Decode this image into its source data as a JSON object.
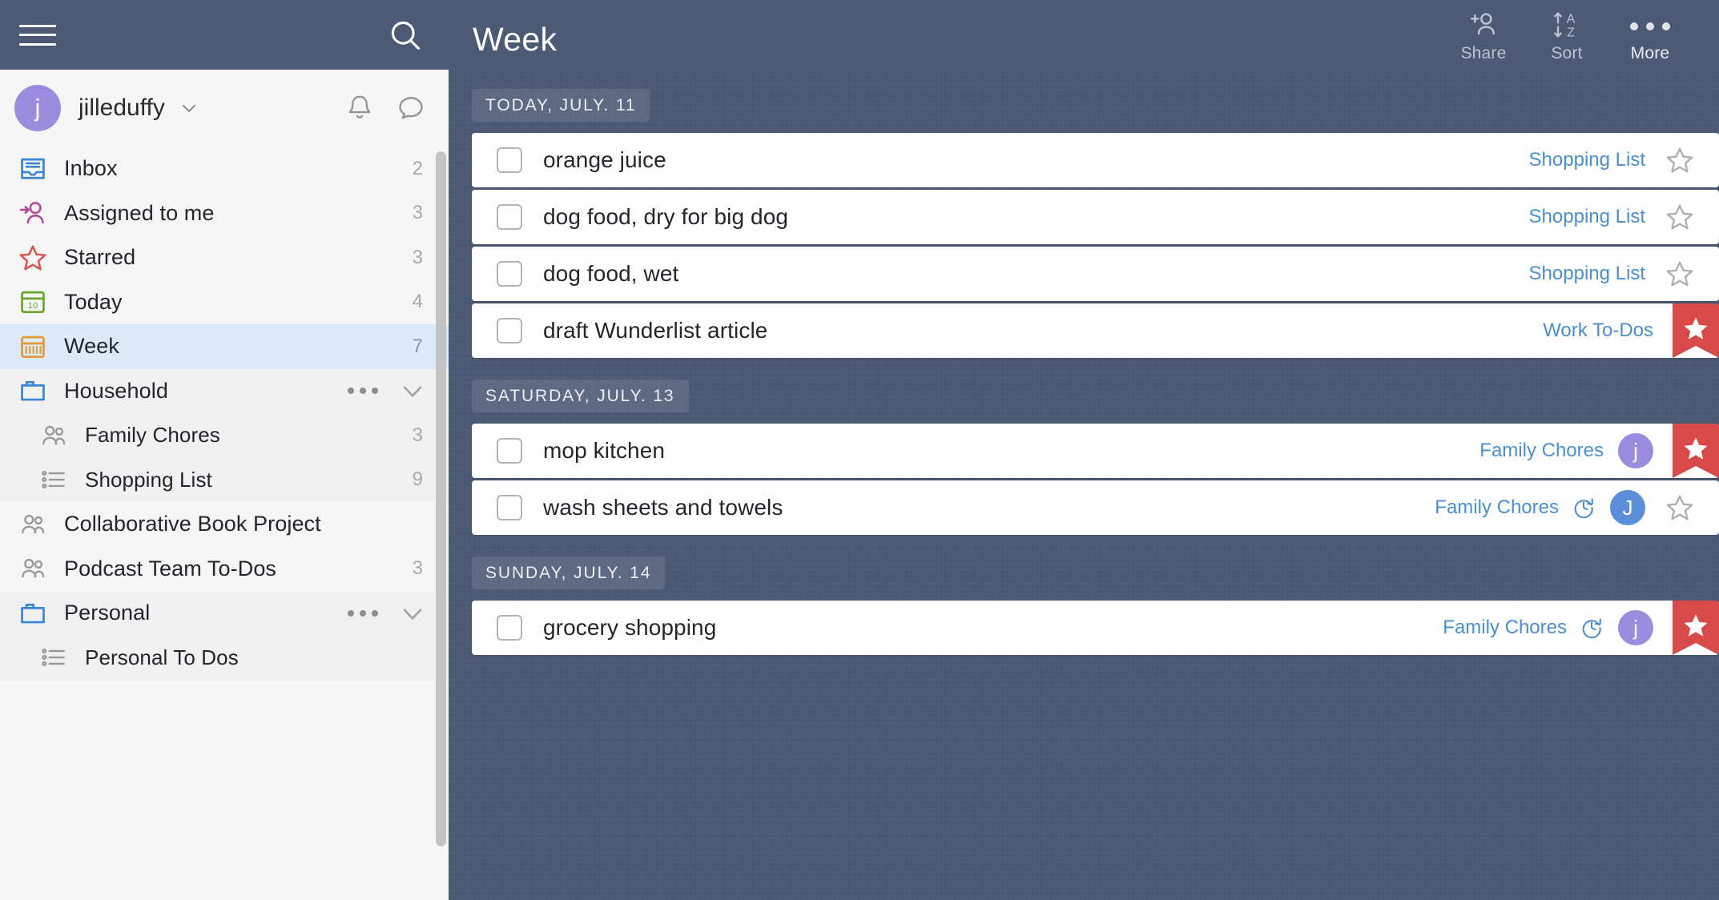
{
  "sidebar": {
    "search_icon": "search-icon",
    "menu_icon": "hamburger-icon",
    "user": {
      "avatar_initial": "j",
      "username": "jilleduffy",
      "avatar_color": "#9b8ce0",
      "dropdown_icon": "chevron-down-icon",
      "bell_icon": "bell-icon",
      "chat_icon": "chat-bubble-icon"
    },
    "smart_lists": [
      {
        "label": "Inbox",
        "count": "2",
        "icon": "inbox-icon",
        "color": "#3b86d6",
        "selected": false
      },
      {
        "label": "Assigned to me",
        "count": "3",
        "icon": "assigned-person-icon",
        "color": "#b5489a",
        "selected": false
      },
      {
        "label": "Starred",
        "count": "3",
        "icon": "star-outline-icon",
        "color": "#d9534f",
        "selected": false
      },
      {
        "label": "Today",
        "count": "4",
        "icon": "calendar-today-icon",
        "color": "#6aa52c",
        "selected": false
      },
      {
        "label": "Week",
        "count": "7",
        "icon": "calendar-week-icon",
        "color": "#e09b37",
        "selected": true
      }
    ],
    "groups": [
      {
        "label": "Household",
        "icon": "folder-icon",
        "more_icon": "more-dots-icon",
        "collapse_icon": "chevron-down-icon",
        "lists": [
          {
            "label": "Family Chores",
            "count": "3",
            "icon": "shared-list-icon"
          },
          {
            "label": "Shopping List",
            "count": "9",
            "icon": "list-icon"
          }
        ]
      }
    ],
    "standalone_lists": [
      {
        "label": "Collaborative Book Project",
        "count": "",
        "icon": "shared-list-icon"
      },
      {
        "label": "Podcast Team To-Dos",
        "count": "3",
        "icon": "shared-list-icon"
      }
    ],
    "groups2": [
      {
        "label": "Personal",
        "icon": "folder-icon",
        "more_icon": "more-dots-icon",
        "collapse_icon": "chevron-down-icon",
        "lists": [
          {
            "label": "Personal To Dos",
            "count": "",
            "icon": "list-icon"
          }
        ]
      }
    ]
  },
  "header": {
    "title": "Week",
    "actions": [
      {
        "label": "Share",
        "icon": "add-person-icon"
      },
      {
        "label": "Sort",
        "icon": "sort-az-icon"
      },
      {
        "label": "More",
        "icon": "more-dots-icon"
      }
    ]
  },
  "main": {
    "sections": [
      {
        "date_label": "TODAY, JULY. 11",
        "tasks": [
          {
            "title": "orange juice",
            "list": "Shopping List",
            "starred": false,
            "recurring": false,
            "assignee": null
          },
          {
            "title": "dog food, dry for big dog",
            "list": "Shopping List",
            "starred": false,
            "recurring": false,
            "assignee": null
          },
          {
            "title": "dog food, wet",
            "list": "Shopping List",
            "starred": false,
            "recurring": false,
            "assignee": null
          },
          {
            "title": "draft Wunderlist article",
            "list": "Work To-Dos",
            "starred": true,
            "recurring": false,
            "assignee": null
          }
        ]
      },
      {
        "date_label": "SATURDAY, JULY. 13",
        "tasks": [
          {
            "title": "mop kitchen",
            "list": "Family Chores",
            "starred": true,
            "recurring": false,
            "assignee": {
              "initial": "j",
              "color": "#9b8ce0"
            }
          },
          {
            "title": "wash sheets and towels",
            "list": "Family Chores",
            "starred": false,
            "recurring": true,
            "assignee": {
              "initial": "J",
              "color": "#5b8fd9"
            }
          }
        ]
      },
      {
        "date_label": "SUNDAY, JULY. 14",
        "tasks": [
          {
            "title": "grocery shopping",
            "list": "Family Chores",
            "starred": true,
            "recurring": true,
            "assignee": {
              "initial": "j",
              "color": "#9b8ce0"
            }
          }
        ]
      }
    ]
  },
  "colors": {
    "chrome": "#4c5a75",
    "sidebar_bg": "#f6f6f6",
    "selected_row": "#ddeaf7",
    "link_blue": "#4a8ed4",
    "flag_red": "#d84a4a"
  }
}
